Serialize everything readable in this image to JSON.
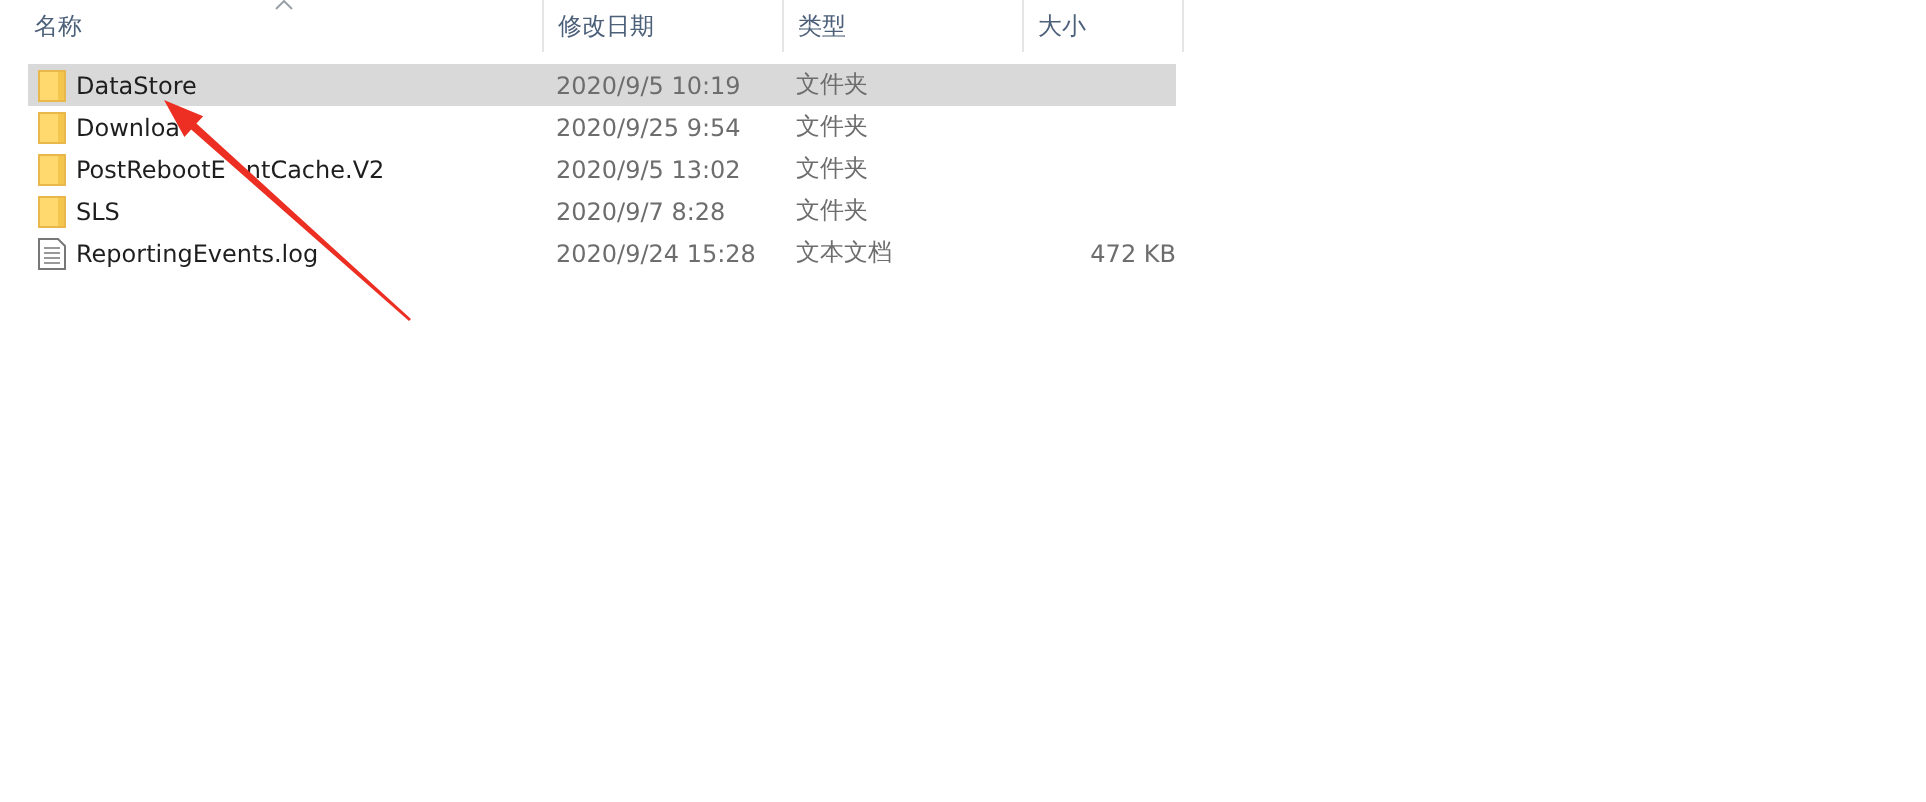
{
  "columns": [
    {
      "label": "名称",
      "sorted": true
    },
    {
      "label": "修改日期"
    },
    {
      "label": "类型"
    },
    {
      "label": "大小"
    }
  ],
  "rows": [
    {
      "name": "DataStore",
      "date": "2020/9/5 10:19",
      "type": "文件夹",
      "size": "",
      "kind": "folder",
      "selected": true
    },
    {
      "name": "Downloa",
      "date": "2020/9/25 9:54",
      "type": "文件夹",
      "size": "",
      "kind": "folder",
      "selected": false
    },
    {
      "name": "PostRebootE",
      "name_rest": "ntCache.V2",
      "date": "2020/9/5 13:02",
      "type": "文件夹",
      "size": "",
      "kind": "folder",
      "selected": false
    },
    {
      "name": "SLS",
      "date": "2020/9/7 8:28",
      "type": "文件夹",
      "size": "",
      "kind": "folder",
      "selected": false
    },
    {
      "name": "ReportingEvents.log",
      "date": "2020/9/24 15:28",
      "type": "文本文档",
      "size": "472 KB",
      "kind": "file",
      "selected": false
    }
  ]
}
